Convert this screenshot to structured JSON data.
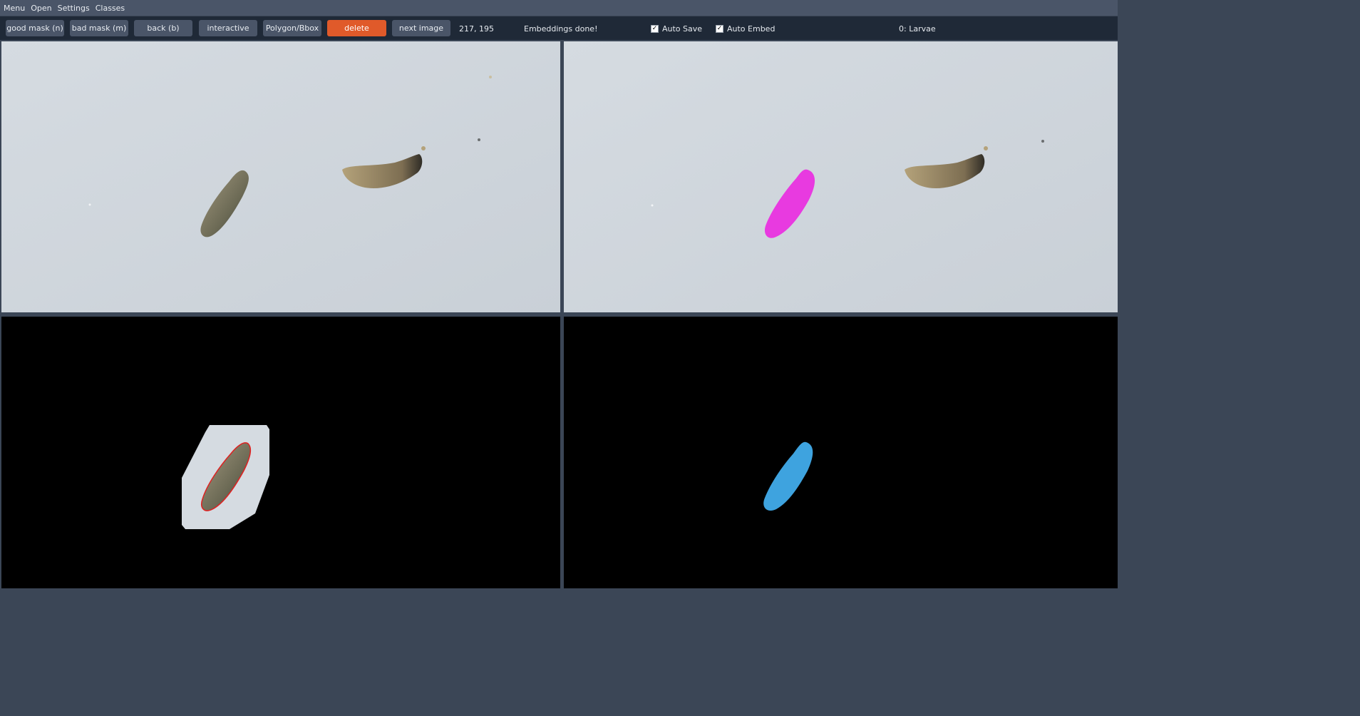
{
  "menubar": {
    "items": [
      "Menu",
      "Open",
      "Settings",
      "Classes"
    ]
  },
  "toolbar": {
    "good_mask_label": "good mask (n)",
    "bad_mask_label": "bad mask (m)",
    "back_label": "back (b)",
    "interactive_label": "interactive",
    "polygon_label": "Polygon/Bbox",
    "delete_label": "delete",
    "next_image_label": "next image",
    "cursor_position": "217, 195",
    "status": "Embeddings done!",
    "auto_save": {
      "label": "Auto Save",
      "checked": true
    },
    "auto_embed": {
      "label": "Auto Embed",
      "checked": true
    },
    "current_class": "0: Larvae"
  },
  "colors": {
    "delete_button": "#e05a2a",
    "mask_preview": "#e83ae0",
    "class_mask": "#3ea3df",
    "contour": "#e02020"
  },
  "panels": {
    "source_image": "original larvae photo",
    "mask_overlay": "magenta mask overlay",
    "crop_view": "cropped object with red contour",
    "mask_output": "blue class mask"
  }
}
